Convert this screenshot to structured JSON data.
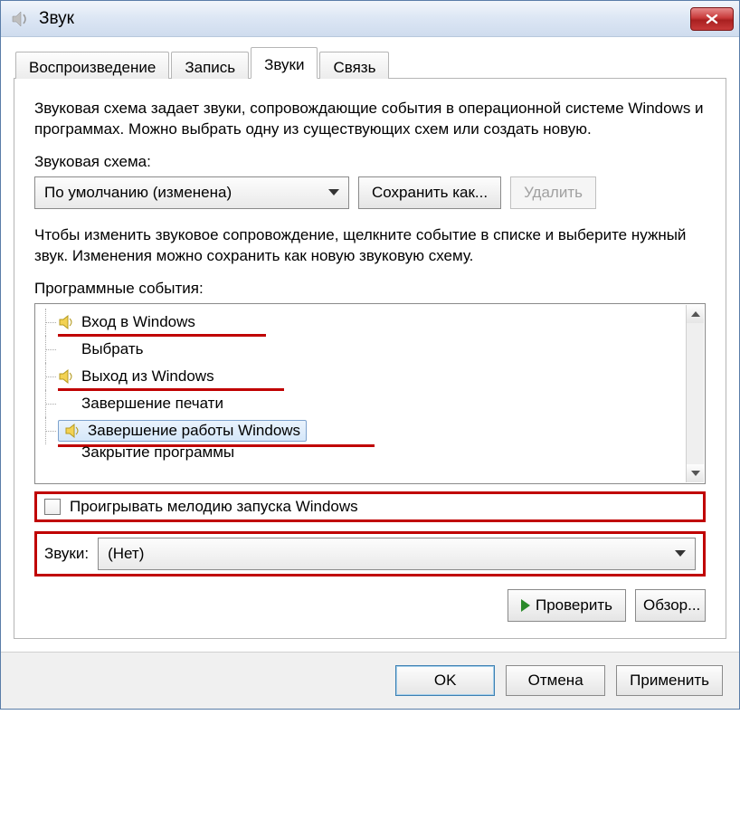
{
  "window": {
    "title": "Звук"
  },
  "tabs": {
    "playback": "Воспроизведение",
    "recording": "Запись",
    "sounds": "Звуки",
    "communications": "Связь"
  },
  "page": {
    "description": "Звуковая схема задает звуки, сопровождающие события в операционной системе Windows и программах. Можно выбрать одну из существующих схем или создать новую.",
    "scheme_label": "Звуковая схема:",
    "scheme_value": "По умолчанию (изменена)",
    "save_as": "Сохранить как...",
    "delete": "Удалить",
    "events_desc": "Чтобы изменить звуковое сопровождение, щелкните событие в списке и выберите нужный звук. Изменения можно сохранить как новую звуковую схему.",
    "events_label": "Программные события:",
    "events": [
      {
        "icon": true,
        "label": "Вход в Windows"
      },
      {
        "icon": false,
        "label": "Выбрать"
      },
      {
        "icon": true,
        "label": "Выход из Windows"
      },
      {
        "icon": false,
        "label": "Завершение печати"
      },
      {
        "icon": true,
        "label": "Завершение работы Windows",
        "selected": true
      },
      {
        "icon": false,
        "label": "Закрытие программы"
      }
    ],
    "play_startup": "Проигрывать мелодию запуска Windows",
    "sounds_label": "Звуки:",
    "sounds_value": "(Нет)",
    "test": "Проверить",
    "browse": "Обзор..."
  },
  "footer": {
    "ok": "OK",
    "cancel": "Отмена",
    "apply": "Применить"
  }
}
